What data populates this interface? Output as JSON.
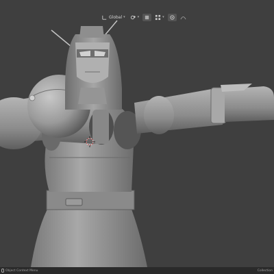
{
  "viewport": {
    "label": "3D Viewport",
    "subject": "robot-model"
  },
  "header": {
    "transform_orientation": "Global",
    "pivot_icon": "pivot-point-icon",
    "snap_icon": "magnet-snap-icon",
    "snap_increment_icon": "snap-grid-icon",
    "proportional_icon": "proportional-edit-icon",
    "falloff_icon": "falloff-curve-icon"
  },
  "status_bar": {
    "left_text": "Object Context Menu",
    "right_text": "Collection"
  },
  "colors": {
    "viewport_bg": "#3f3f3f",
    "header_active": "#4772b3",
    "model": "#8e8e8e"
  }
}
